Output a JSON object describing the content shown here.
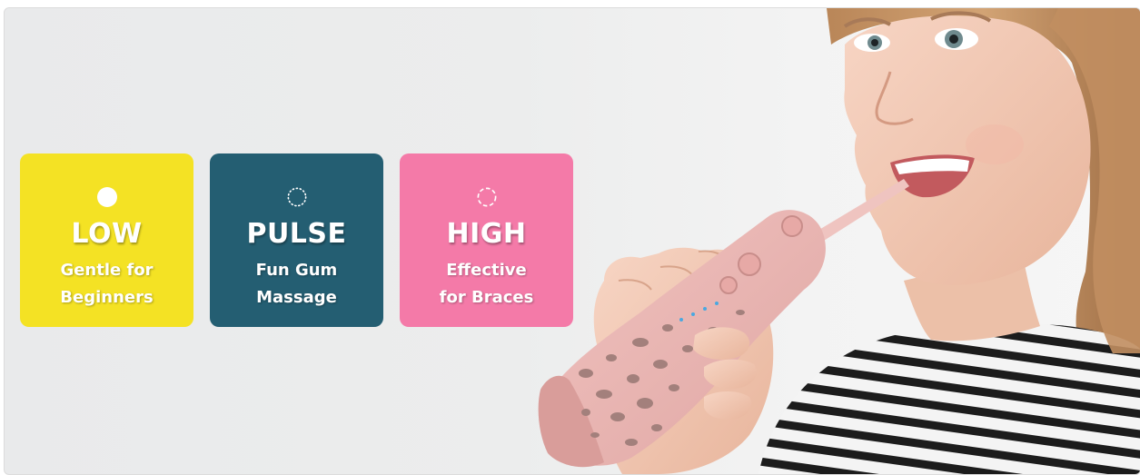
{
  "banner": {
    "modes": [
      {
        "title": "LOW",
        "line1": "Gentle for",
        "line2": "Beginners",
        "color": "#f4e224",
        "icon": "solid-circle-icon"
      },
      {
        "title": "PULSE",
        "line1": "Fun Gum",
        "line2": "Massage",
        "color": "#245e72",
        "icon": "dotted-circle-icon"
      },
      {
        "title": "HIGH",
        "line1": "Effective",
        "line2": "for Braces",
        "color": "#f47aa8",
        "icon": "dashed-circle-icon"
      }
    ],
    "photo": {
      "subject": "smiling-girl-with-pink-water-flosser",
      "product_color": "#e9b4b4",
      "spot_color": "#a3807c"
    }
  }
}
